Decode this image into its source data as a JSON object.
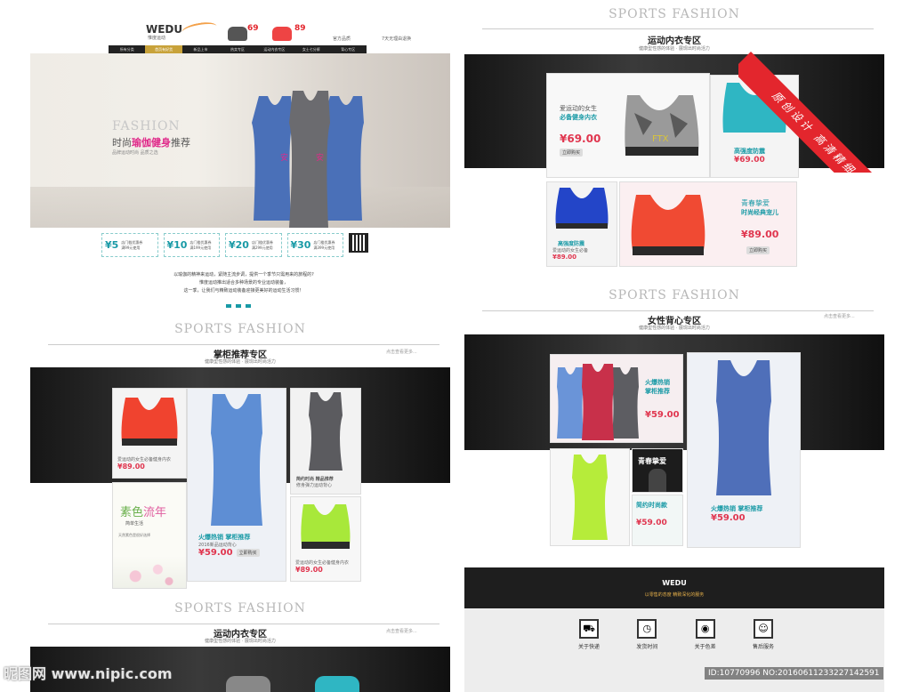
{
  "brand": {
    "logo": "WEDU",
    "logo_sub": "惟度运动",
    "badge1": "69",
    "badge2": "89",
    "badge_info1": "官方品质",
    "badge_info2": "7天无理由退换"
  },
  "nav": [
    "所有分类",
    "首页有好货",
    "新品上市",
    "热卖专区",
    "运动内衣专区",
    "女士七分裤",
    "背心专区"
  ],
  "hero": {
    "en": "FASHION",
    "title_a": "时尚",
    "title_b": "瑜伽健身",
    "title_c": "推荐",
    "line": "品牌运动时尚 品质之选"
  },
  "coupons": [
    {
      "amount": "¥5",
      "text": "店门槛优惠券",
      "cond": "满99元使用"
    },
    {
      "amount": "¥10",
      "text": "店门槛优惠券",
      "cond": "满199元使用"
    },
    {
      "amount": "¥20",
      "text": "店门槛优惠券",
      "cond": "满299元使用"
    },
    {
      "amount": "¥30",
      "text": "店门槛优惠券",
      "cond": "满399元使用"
    }
  ],
  "intro_lines": [
    "以瑜伽的精神来运动，紧随主流步调，提供一个季节只需用来的旅程的?",
    "惟度运动推出适合多种场景的专业运动装备，",
    "这一季，让我们与精致运动装备迎接更美好的运动生活习惯！"
  ],
  "sections": {
    "en": "SPORTS FASHION",
    "more": "点击查看更多...",
    "sub": "健康型性感的体验 · 展现出时尚活力",
    "left_title": "掌柜推荐专区",
    "left_bottom_title": "运动内衣专区",
    "right_top_title": "运动内衣专区",
    "right_mid_title": "女性背心专区"
  },
  "left_products": {
    "red_bra": {
      "desc": "爱运动的女生必备健身内衣",
      "price": "¥89.00"
    },
    "promo": {
      "title_a": "素色",
      "title_b": "流年",
      "line": "简单生活",
      "txt": "天然素色是很好选择"
    },
    "blue_tank": {
      "title": "火爆热销 掌柜推荐",
      "desc": "2016新品运动背心",
      "price": "¥59.00",
      "buy": "立即购买"
    },
    "gray_tank": {
      "title": "简约时尚 精品推荐",
      "desc": "修身弹力运动背心"
    },
    "lime_bra": {
      "desc": "爱运动的女生必备健身内衣",
      "price": "¥89.00"
    }
  },
  "right_bras": {
    "card1": {
      "line1": "爱运动的女生",
      "line2": "必备健身内衣",
      "price": "¥69.00",
      "buy": "立即购买"
    },
    "card2": {
      "title": "高强度防震",
      "price": "¥69.00"
    },
    "card3": {
      "title": "高强度防震",
      "desc": "爱运动的女生必备",
      "price": "¥89.00"
    },
    "card4": {
      "line1": "青春挚爱",
      "line2": "时尚经典宠儿",
      "price": "¥89.00",
      "buy": "立即购买"
    }
  },
  "right_vests": {
    "card1": {
      "line1": "火爆热销",
      "line2": "掌柜推荐",
      "price": "¥59.00"
    },
    "card2": {
      "title": "火爆热销 掌柜推荐",
      "price": "¥59.00"
    },
    "card3": {
      "label": "青春挚爱"
    },
    "card4": {
      "title": "简约时尚款",
      "price": "¥59.00"
    }
  },
  "footer": {
    "logo": "WEDU",
    "tagline": "以零售的态度 精致深化的服务",
    "services": [
      "关于快递",
      "发货时间",
      "关于色差",
      "售后服务"
    ]
  },
  "watermark": {
    "corner": "原创设计 高清精细分层",
    "site": "昵图网 www.nipic.com",
    "id": "ID:10770996 NO:20160611233227142591"
  },
  "colors": {
    "accent": "#e0364f",
    "teal": "#199aa6",
    "badge_red": "#e3262d"
  }
}
